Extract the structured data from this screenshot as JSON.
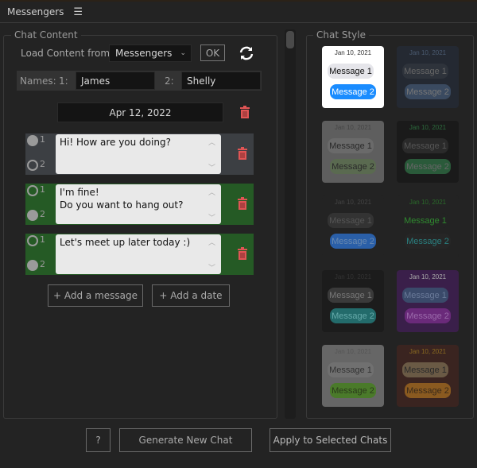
{
  "title": "Messengers",
  "chat_content": {
    "legend": "Chat Content",
    "load_label": "Load Content from:",
    "load_value": "Messengers",
    "ok": "OK",
    "names_label": "Names:",
    "n1_label": "1:",
    "n1": "James",
    "n2_label": "2:",
    "n2": "Shelly",
    "date": "Apr 12, 2022",
    "messages": [
      {
        "text": "Hi! How are you doing?",
        "sender": 1,
        "color": "#3c3f43"
      },
      {
        "text": "I'm fine!\nDo you want to hang out?",
        "sender": 2,
        "color": "#255a25"
      },
      {
        "text": "Let's meet up later today :)",
        "sender": 2,
        "color": "#255a25"
      }
    ],
    "radio1": "1",
    "radio2": "2",
    "add_message": "+ Add a message",
    "add_date": "+ Add a date"
  },
  "chat_style": {
    "legend": "Chat Style",
    "date": "Jan 10, 2021",
    "m1": "Message 1",
    "m2": "Message 2",
    "styles": [
      {
        "bg": "#ffffff",
        "date": "#333",
        "m1bg": "#e5e5ea",
        "m1fg": "#111",
        "m2bg": "#1a8cff",
        "m2fg": "#fff",
        "selected": true
      },
      {
        "bg": "#242932",
        "date": "#4a5a70",
        "m1bg": "#2e333b",
        "m1fg": "#666",
        "m2bg": "#3a4a60",
        "m2fg": "#777"
      },
      {
        "bg": "#5e5e5e",
        "date": "#444",
        "m1bg": "#6a6a6a",
        "m1fg": "#2a2a2a",
        "m2bg": "#5a6a50",
        "m2fg": "#2a2a2a"
      },
      {
        "bg": "#1a1a1a",
        "date": "#2c6a3c",
        "m1bg": "#2a2a2a",
        "m1fg": "#555",
        "m2bg": "#2a5a3a",
        "m2fg": "#666"
      },
      {
        "bg": "#232323",
        "date": "#444",
        "m1bg": "#333",
        "m1fg": "#555",
        "m2bg": "#2a5fa8",
        "m2fg": "#6a8ab0"
      },
      {
        "bg": "#232323",
        "date": "#2a6a2a",
        "m1bg": "#232323",
        "m1fg": "#2f8a2f",
        "m2bg": "#262626",
        "m2fg": "#2a8080"
      },
      {
        "bg": "#1c1c1c",
        "date": "#333",
        "m1bg": "#3a3a3a",
        "m1fg": "#777",
        "m2bg": "#236b6b",
        "m2fg": "#6aa"
      },
      {
        "bg": "#3a1f4a",
        "date": "#aaa",
        "m1bg": "#3a4a6a",
        "m1fg": "#6a7a99",
        "m2bg": "#6a2a7a",
        "m2fg": "#9a6aaa"
      },
      {
        "bg": "#666666",
        "date": "#555",
        "m1bg": "#707070",
        "m1fg": "#333",
        "m2bg": "#4a7a2a",
        "m2fg": "#2a3a1a"
      },
      {
        "bg": "#3a2420",
        "date": "#8a6a20",
        "m1bg": "#6a5a45",
        "m1fg": "#2a2a2a",
        "m2bg": "#8a5a20",
        "m2fg": "#3a2a1a"
      }
    ]
  },
  "footer": {
    "help": "?",
    "generate": "Generate New Chat",
    "apply": "Apply to Selected Chats"
  },
  "colors": {
    "trash": "#e05555"
  }
}
